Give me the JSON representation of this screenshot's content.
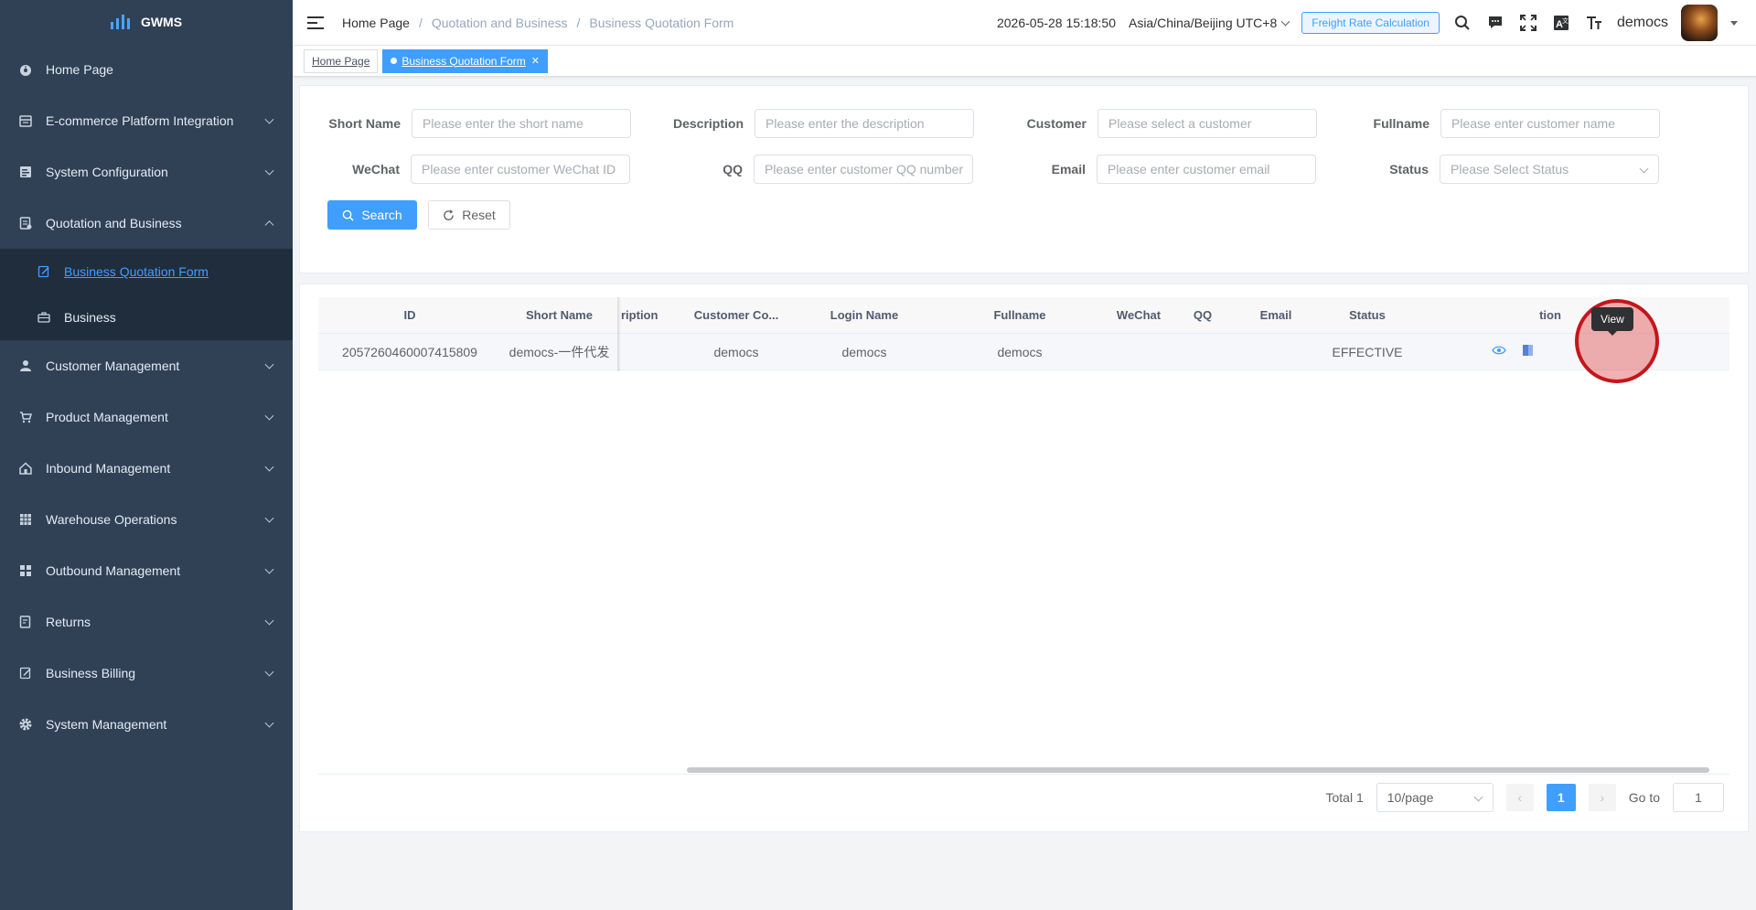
{
  "app": {
    "logo_text": "GWMS"
  },
  "sidebar": {
    "items": [
      {
        "label": "Home Page",
        "icon": "dashboard-icon"
      },
      {
        "label": "E-commerce Platform Integration",
        "icon": "store-icon"
      },
      {
        "label": "System Configuration",
        "icon": "config-icon"
      },
      {
        "label": "Quotation and Business",
        "icon": "quotation-icon"
      },
      {
        "label": "Customer Management",
        "icon": "user-icon"
      },
      {
        "label": "Product Management",
        "icon": "cart-icon"
      },
      {
        "label": "Inbound Management",
        "icon": "home-icon"
      },
      {
        "label": "Warehouse Operations",
        "icon": "grid-icon"
      },
      {
        "label": "Outbound Management",
        "icon": "apps-icon"
      },
      {
        "label": "Returns",
        "icon": "returns-icon"
      },
      {
        "label": "Business Billing",
        "icon": "billing-icon"
      },
      {
        "label": "System Management",
        "icon": "gear-icon"
      }
    ],
    "sub_items": [
      {
        "label": "Business Quotation Form",
        "icon": "edit-icon"
      },
      {
        "label": "Business",
        "icon": "briefcase-icon"
      }
    ]
  },
  "header": {
    "breadcrumb": [
      "Home Page",
      "Quotation and Business",
      "Business Quotation Form"
    ],
    "datetime": "2026-05-28 15:18:50",
    "timezone": "Asia/China/Beijing UTC+8",
    "freight_button": "Freight Rate Calculation",
    "username": "democs"
  },
  "tags": [
    {
      "label": "Home Page"
    },
    {
      "label": "Business Quotation Form"
    }
  ],
  "search_form": {
    "short_name": {
      "label": "Short Name",
      "placeholder": "Please enter the short name"
    },
    "description": {
      "label": "Description",
      "placeholder": "Please enter the description"
    },
    "customer": {
      "label": "Customer",
      "placeholder": "Please select a customer"
    },
    "fullname": {
      "label": "Fullname",
      "placeholder": "Please enter customer name"
    },
    "wechat": {
      "label": "WeChat",
      "placeholder": "Please enter customer WeChat ID"
    },
    "qq": {
      "label": "QQ",
      "placeholder": "Please enter customer QQ number"
    },
    "email": {
      "label": "Email",
      "placeholder": "Please enter customer email"
    },
    "status": {
      "label": "Status",
      "placeholder": "Please Select Status"
    },
    "search_button": "Search",
    "reset_button": "Reset"
  },
  "table": {
    "columns": [
      "ID",
      "Short Name",
      "ription",
      "Customer Co...",
      "Login Name",
      "Fullname",
      "WeChat",
      "QQ",
      "Email",
      "Status",
      "tion"
    ],
    "rows": [
      [
        "2057260460007415809",
        "democs-一件代发",
        "",
        "democs",
        "democs",
        "democs",
        "",
        "",
        "",
        "EFFECTIVE"
      ]
    ],
    "tooltip": "View"
  },
  "pagination": {
    "total": "Total 1",
    "page_size": "10/page",
    "current_page": "1",
    "goto_label": "Go to",
    "goto_value": "1"
  },
  "colors": {
    "sidebar_bg": "#304156",
    "submenu_bg": "#1f2d3d",
    "primary": "#409eff",
    "highlight": "#c4161c"
  }
}
